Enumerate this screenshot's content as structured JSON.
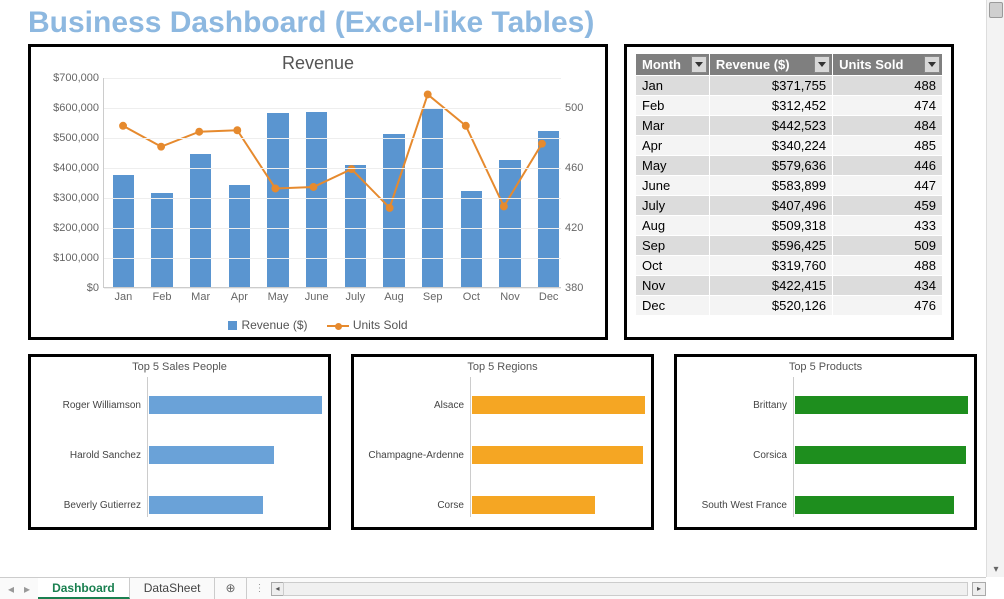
{
  "title": "Business Dashboard (Excel-like Tables)",
  "chart_data": [
    {
      "type": "bar+line",
      "title": "Revenue",
      "categories": [
        "Jan",
        "Feb",
        "Mar",
        "Apr",
        "May",
        "June",
        "July",
        "Aug",
        "Sep",
        "Oct",
        "Nov",
        "Dec"
      ],
      "series": [
        {
          "name": "Revenue ($)",
          "axis": "left",
          "kind": "bar",
          "values": [
            371755,
            312452,
            442523,
            340224,
            579636,
            583899,
            407496,
            509318,
            596425,
            319760,
            422415,
            520126
          ]
        },
        {
          "name": "Units Sold",
          "axis": "right",
          "kind": "line",
          "values": [
            488,
            474,
            484,
            485,
            446,
            447,
            459,
            433,
            509,
            488,
            434,
            476
          ]
        }
      ],
      "y_left": {
        "min": 0,
        "max": 700000,
        "ticks": [
          0,
          100000,
          200000,
          300000,
          400000,
          500000,
          600000,
          700000
        ],
        "tick_labels": [
          "$0",
          "$100,000",
          "$200,000",
          "$300,000",
          "$400,000",
          "$500,000",
          "$600,000",
          "$700,000"
        ]
      },
      "y_right": {
        "min": 380,
        "max": 520,
        "ticks": [
          380,
          420,
          460,
          500
        ]
      }
    },
    {
      "type": "hbar",
      "title": "Top 5 Sales People",
      "categories": [
        "Roger Williamson",
        "Harold Sanchez",
        "Beverly Gutierrez"
      ],
      "values": [
        100,
        72,
        66
      ],
      "color": "#6aa2d8"
    },
    {
      "type": "hbar",
      "title": "Top 5 Regions",
      "categories": [
        "Alsace",
        "Champagne-Ardenne",
        "Corse"
      ],
      "values": [
        100,
        99,
        71
      ],
      "color": "#f5a623"
    },
    {
      "type": "hbar",
      "title": "Top 5 Products",
      "categories": [
        "Brittany",
        "Corsica",
        "South West France"
      ],
      "values": [
        100,
        99,
        92
      ],
      "color": "#1e8e1e"
    }
  ],
  "table": {
    "headers": [
      "Month",
      "Revenue ($)",
      "Units Sold"
    ],
    "rows": [
      [
        "Jan",
        "$371,755",
        "488"
      ],
      [
        "Feb",
        "$312,452",
        "474"
      ],
      [
        "Mar",
        "$442,523",
        "484"
      ],
      [
        "Apr",
        "$340,224",
        "485"
      ],
      [
        "May",
        "$579,636",
        "446"
      ],
      [
        "June",
        "$583,899",
        "447"
      ],
      [
        "July",
        "$407,496",
        "459"
      ],
      [
        "Aug",
        "$509,318",
        "433"
      ],
      [
        "Sep",
        "$596,425",
        "509"
      ],
      [
        "Oct",
        "$319,760",
        "488"
      ],
      [
        "Nov",
        "$422,415",
        "434"
      ],
      [
        "Dec",
        "$520,126",
        "476"
      ]
    ]
  },
  "legend": {
    "bar": "Revenue ($)",
    "line": "Units Sold"
  },
  "tabs": {
    "active": "Dashboard",
    "inactive": "DataSheet"
  }
}
